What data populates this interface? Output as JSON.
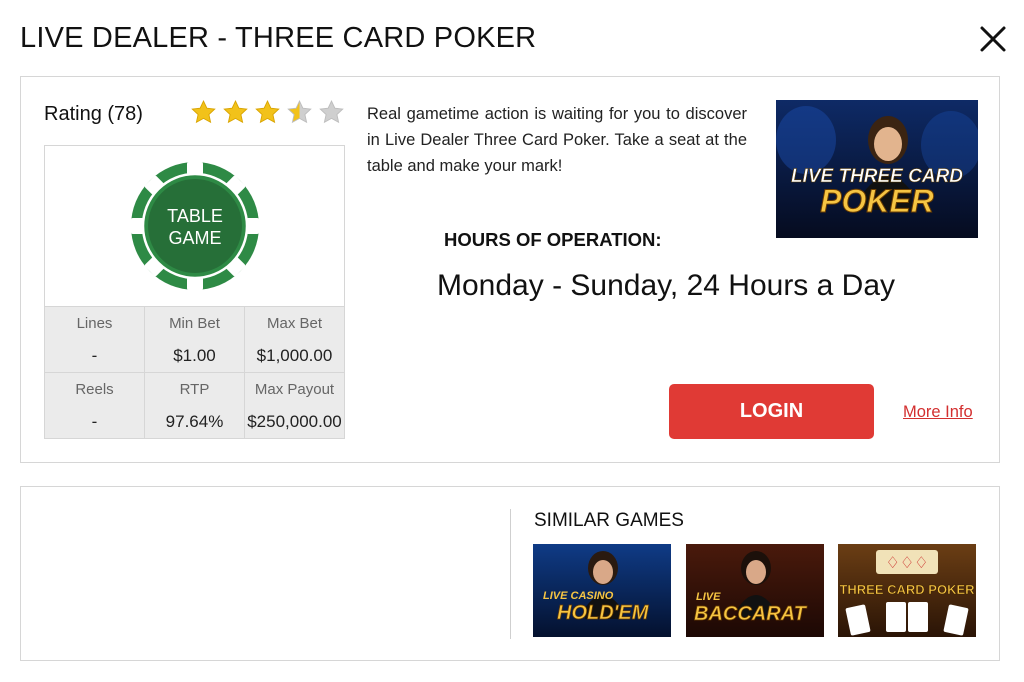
{
  "modal": {
    "title": "LIVE DEALER - THREE CARD POKER",
    "close_icon": "close-icon"
  },
  "rating": {
    "label": "Rating (78)",
    "stars_filled": 3.5,
    "stars_total": 5,
    "star_color": "#f2c21a"
  },
  "chip": {
    "line1": "TABLE",
    "line2": "GAME",
    "color": "#2e8a45"
  },
  "stats": [
    {
      "label": "Lines",
      "value": "-"
    },
    {
      "label": "Min Bet",
      "value": "$1.00"
    },
    {
      "label": "Max Bet",
      "value": "$1,000.00"
    },
    {
      "label": "Reels",
      "value": "-"
    },
    {
      "label": "RTP",
      "value": "97.64%"
    },
    {
      "label": "Max Payout",
      "value": "$250,000.00"
    }
  ],
  "description": "Real gametime action is waiting for you to discover in Live Dealer Three Card Poker. Take a seat at the table and make your mark!",
  "main_thumbnail": {
    "line1": "LIVE THREE CARD",
    "line2": "POKER"
  },
  "hours": {
    "label": "HOURS OF OPERATION:",
    "value": "Monday - Sunday, 24 Hours a Day"
  },
  "actions": {
    "login_label": "LOGIN",
    "more_info_label": "More Info",
    "accent_color": "#e03a35"
  },
  "similar": {
    "title": "SIMILAR GAMES",
    "games": [
      {
        "line1": "LIVE CASINO",
        "line2": "HOLD'EM"
      },
      {
        "line1": "LIVE",
        "line2": "BACCARAT"
      },
      {
        "line1": "THREE CARD POKER",
        "line2": ""
      }
    ]
  }
}
